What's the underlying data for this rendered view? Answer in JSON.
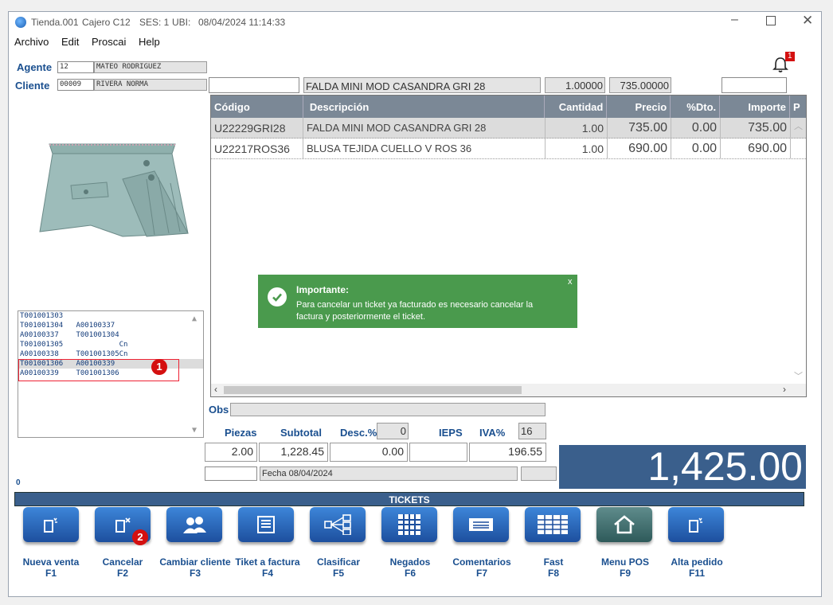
{
  "window": {
    "title_app": "Tienda.001",
    "title_cashier": "Cajero C12",
    "title_session": "SES: 1",
    "title_ubi": "UBI:",
    "title_datetime": "08/04/2024 11:14:33"
  },
  "menu": [
    "Archivo",
    "Edit",
    "Proscai",
    "Help"
  ],
  "notification_count": "1",
  "agent": {
    "label": "Agente",
    "code": "12",
    "name": "MATEO RODRIGUEZ"
  },
  "client": {
    "label": "Cliente",
    "code": "00009",
    "name": "RIVERA NORMA"
  },
  "product_entry": {
    "code": "",
    "description": "FALDA MINI MOD CASANDRA GRI 28",
    "qty": "1.00000",
    "price": "735.00000",
    "extra": ""
  },
  "grid": {
    "headers": [
      "Código",
      "Descripción",
      "Cantidad",
      "Precio",
      "%Dto.",
      "Importe",
      "P"
    ],
    "rows": [
      {
        "code": "U22229GRI28",
        "desc": "FALDA MINI MOD CASANDRA GRI 28",
        "qty": "1.00",
        "price": "735.00",
        "dto": "0.00",
        "amount": "735.00"
      },
      {
        "code": "U22217ROS36",
        "desc": "BLUSA TEJIDA CUELLO V ROS 36",
        "qty": "1.00",
        "price": "690.00",
        "dto": "0.00",
        "amount": "690.00"
      }
    ]
  },
  "toast": {
    "title": "Importante:",
    "message": "Para cancelar un ticket ya facturado es necesario cancelar la factura y posteriormente el ticket.",
    "close": "x"
  },
  "ticket_list": [
    "T001001303",
    "T001001304   A00100337",
    "A00100337    T001001304",
    "T001001305             Cn",
    "A00100338    T001001305Cn",
    "T001001306   A00100339",
    "A00100339    T001001306"
  ],
  "ticket_list_selected_index": 5,
  "callouts": {
    "one": "1",
    "two": "2"
  },
  "obs": {
    "label": "Obs",
    "value": ""
  },
  "totals": {
    "piezas_label": "Piezas",
    "piezas": "2.00",
    "subtotal_label": "Subtotal",
    "subtotal": "1,228.45",
    "desc_label": "Desc.%",
    "desc_pct": "0",
    "desc_value": "0.00",
    "ieps_label": "IEPS",
    "ieps_value": "",
    "iva_label": "IVA%",
    "iva_pct": "16",
    "iva_value": "196.55",
    "fecha": "Fecha 08/04/2024",
    "grand_total": "1,425.00",
    "left_counter": "0"
  },
  "tickets_bar": "TICKETS",
  "function_buttons": [
    {
      "label": "Nueva venta",
      "key": "F1",
      "icon": "new-sale-icon"
    },
    {
      "label": "Cancelar",
      "key": "F2",
      "icon": "cancel-icon"
    },
    {
      "label": "Cambiar cliente",
      "key": "F3",
      "icon": "users-icon"
    },
    {
      "label": "Tiket a factura",
      "key": "F4",
      "icon": "invoice-icon"
    },
    {
      "label": "Clasificar",
      "key": "F5",
      "icon": "hierarchy-icon"
    },
    {
      "label": "Negados",
      "key": "F6",
      "icon": "grid-icon"
    },
    {
      "label": "Comentarios",
      "key": "F7",
      "icon": "comment-icon"
    },
    {
      "label": "Fast",
      "key": "F8",
      "icon": "table-icon"
    },
    {
      "label": "Menu POS",
      "key": "F9",
      "icon": "home-icon"
    },
    {
      "label": "Alta pedido",
      "key": "F11",
      "icon": "new-order-icon"
    }
  ]
}
